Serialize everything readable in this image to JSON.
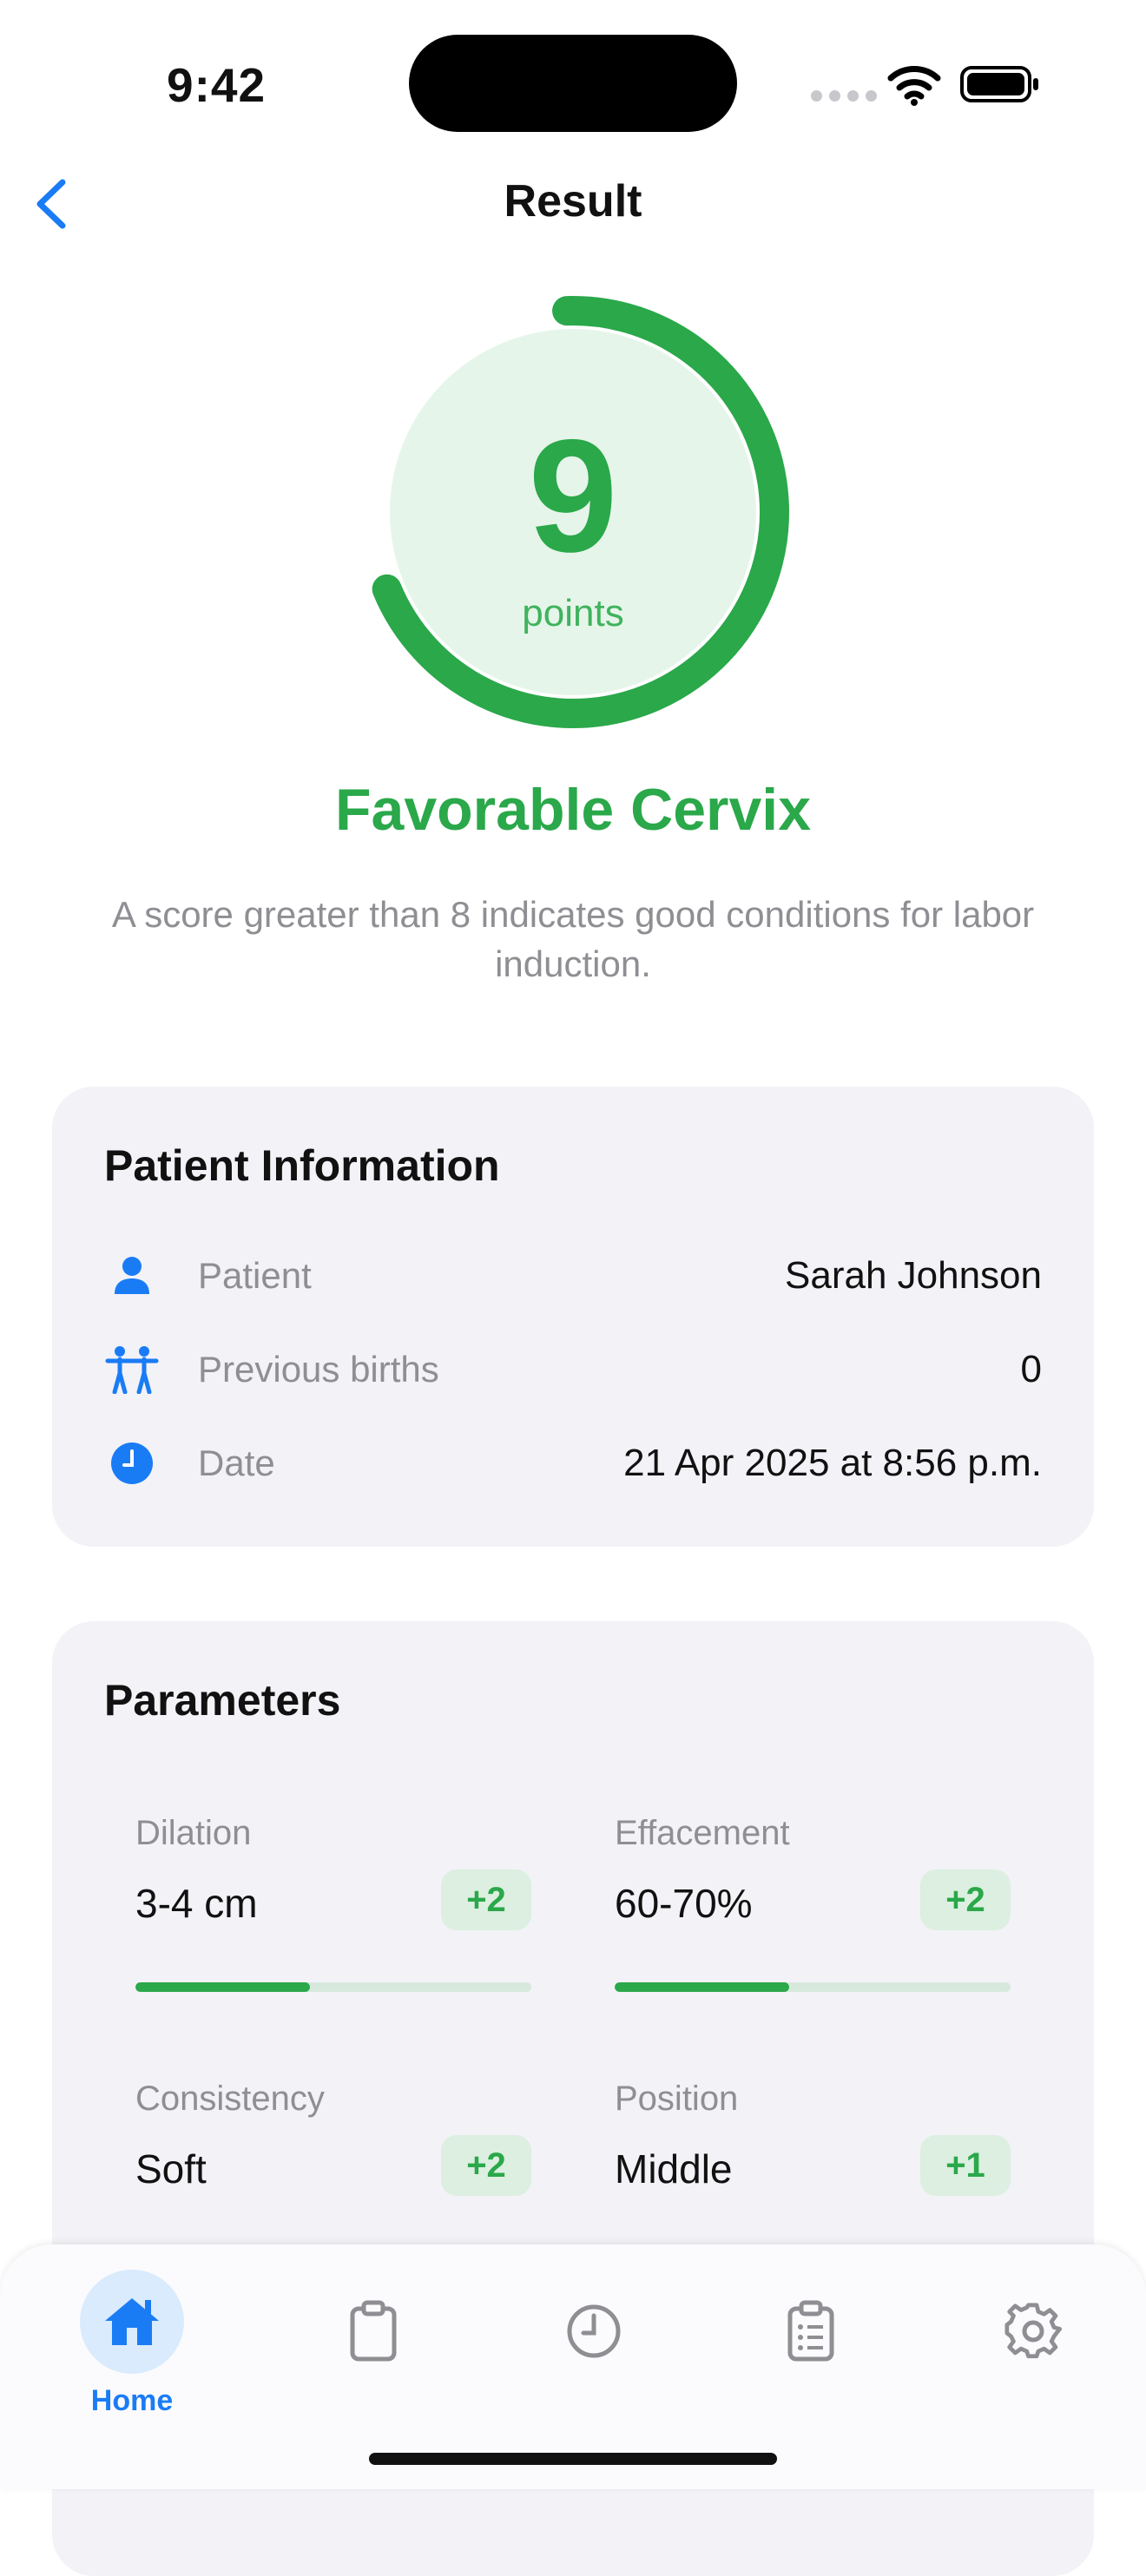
{
  "status_bar": {
    "time": "9:42"
  },
  "nav": {
    "title": "Result"
  },
  "score": {
    "value": "9",
    "unit": "points",
    "max": 13,
    "category": "Favorable Cervix",
    "description": "A score greater than 8 indicates good conditions for labor induction."
  },
  "patient_info": {
    "title": "Patient Information",
    "rows": [
      {
        "icon": "person-icon",
        "label": "Patient",
        "value": "Sarah Johnson"
      },
      {
        "icon": "people-icon",
        "label": "Previous births",
        "value": "0"
      },
      {
        "icon": "clock-icon",
        "label": "Date",
        "value": "21 Apr 2025 at 8:56 p.m."
      }
    ]
  },
  "parameters": {
    "title": "Parameters",
    "items": [
      {
        "label": "Dilation",
        "value": "3-4 cm",
        "score": "+2",
        "fill": 0.44
      },
      {
        "label": "Effacement",
        "value": "60-70%",
        "score": "+2",
        "fill": 0.44
      },
      {
        "label": "Consistency",
        "value": "Soft",
        "score": "+2",
        "fill": 0.44
      },
      {
        "label": "Position",
        "value": "Middle",
        "score": "+1",
        "fill": 0.22
      }
    ]
  },
  "tab_bar": {
    "items": [
      {
        "icon": "house-icon",
        "label": "Home",
        "active": true
      },
      {
        "icon": "clipboard-icon",
        "label": "",
        "active": false
      },
      {
        "icon": "clock-icon",
        "label": "",
        "active": false
      },
      {
        "icon": "checklist-icon",
        "label": "",
        "active": false
      },
      {
        "icon": "gear-icon",
        "label": "",
        "active": false
      }
    ]
  },
  "colors": {
    "accent_green": "#2aa84a",
    "accent_blue": "#1a7cf5",
    "card_bg": "#f2f2f7"
  }
}
